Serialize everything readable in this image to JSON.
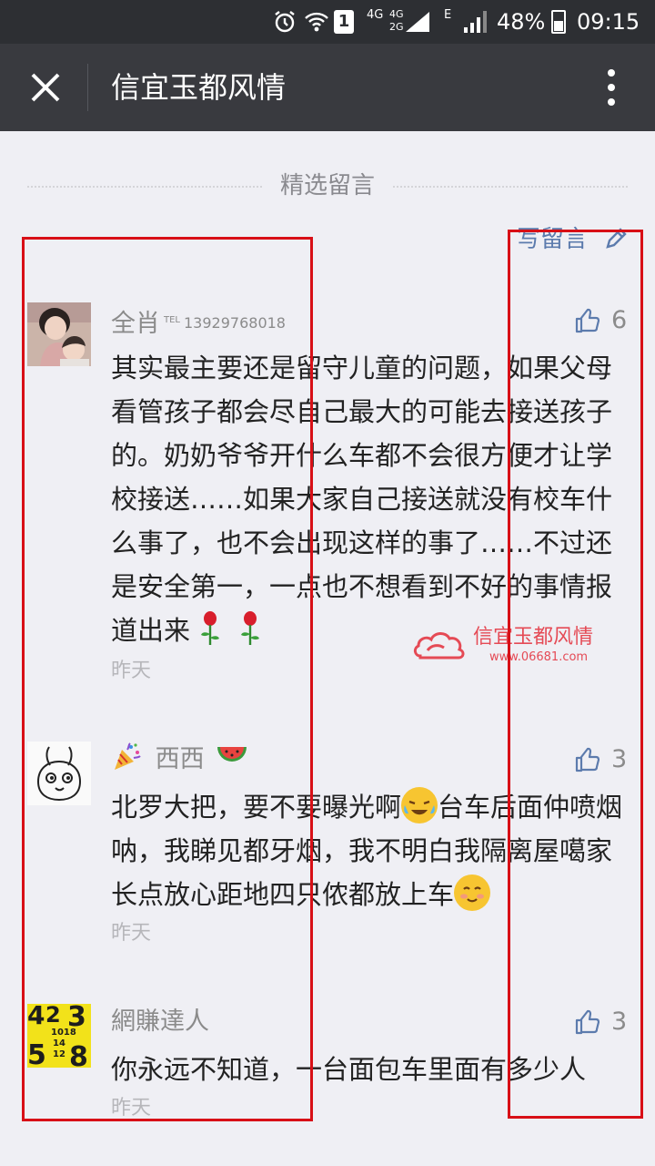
{
  "status_bar": {
    "sim_label": "1",
    "net_4g": "4G",
    "net_4g_small": "4G",
    "net_2g_small": "2G",
    "net_e": "E",
    "battery": "48%",
    "time": "09:15"
  },
  "nav": {
    "title": "信宜玉都风情"
  },
  "section": {
    "title": "精选留言",
    "write_label": "写留言"
  },
  "comments": [
    {
      "nickname": "全肖",
      "nickname_sup": "TEL",
      "nickname_tel": "13929768018",
      "likes": "6",
      "text": "其实最主要还是留守儿童的问题，如果父母看管孩子都会尽自己最大的可能去接送孩子的。奶奶爷爷开什么车都不会很方便才让学校接送……如果大家自己接送就没有校车什么事了，也不会出现这样的事了……不过还是安全第一，一点也不想看到不好的事情报道出来",
      "time": "昨天"
    },
    {
      "nickname": "西西",
      "likes": "3",
      "text_1": "北罗大把，要不要曝光啊",
      "text_2": "台车后面仲喷烟呐，我睇见都牙烟，我不明白我隔离屋噶家长点放心距地四只侬都放上车",
      "time": "昨天"
    },
    {
      "nickname": "網賺達人",
      "likes": "3",
      "text": "你永远不知道，一台面包车里面有多少人",
      "time": "昨天"
    }
  ],
  "watermark": {
    "title": "信宜玉都风情",
    "url": "www.06681.com"
  },
  "avatar3_digits": [
    "4",
    "2",
    "3",
    "1018",
    "14",
    "12",
    "5",
    "8"
  ],
  "colors": {
    "status_bar": "#2d2f33",
    "nav_bar": "#393a3f",
    "background": "#efeff4",
    "link": "#5c7bad",
    "annotation_box": "#d80f16"
  }
}
